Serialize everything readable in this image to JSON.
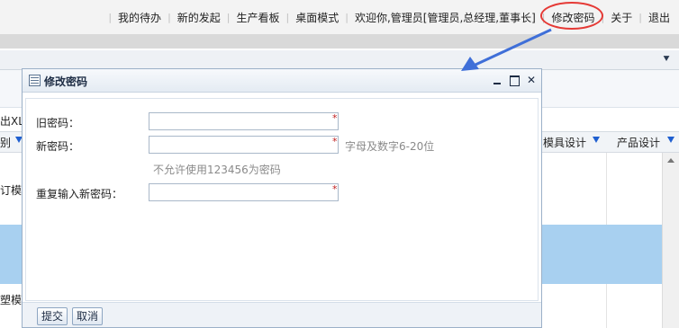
{
  "topnav": {
    "links": [
      "我的待办",
      "新的发起",
      "生产看板",
      "桌面模式",
      "欢迎你,管理员[管理员,总经理,董事长]",
      "修改密码",
      "关于",
      "退出"
    ]
  },
  "background": {
    "export_label": "出XL",
    "col_partial": "别",
    "col_mold_design": "模具设计",
    "col_product_design": "产品设计",
    "row1_partial": "订模具",
    "row2_partial": "塑模具"
  },
  "annotation": {
    "color": "#e53935",
    "arrow_color": "#3f6fd8"
  },
  "dialog": {
    "title": "修改密码",
    "old_password_label": "旧密码：",
    "new_password_label": "新密码：",
    "repeat_password_label": "重复输入新密码：",
    "old_password_value": "",
    "new_password_value": "",
    "repeat_password_value": "",
    "required_mark": "*",
    "new_password_hint": "字母及数字6-20位",
    "forbidden_hint": "不允许使用123456为密码",
    "submit_label": "提交",
    "cancel_label": "取消"
  }
}
